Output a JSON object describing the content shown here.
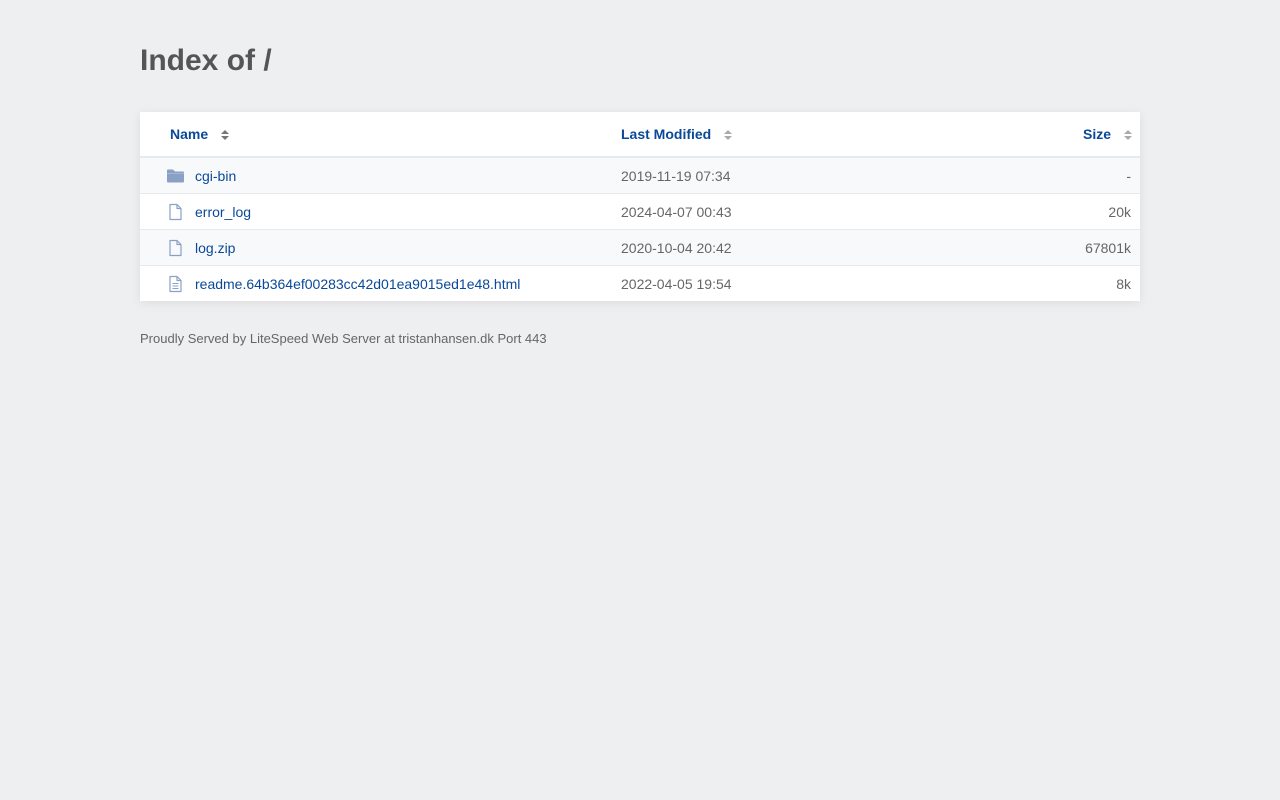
{
  "page": {
    "title": "Index of /"
  },
  "columns": {
    "name": "Name",
    "last_modified": "Last Modified",
    "size": "Size"
  },
  "entries": [
    {
      "name": "cgi-bin",
      "modified": "2019-11-19 07:34",
      "size": "-",
      "icon": "folder-icon"
    },
    {
      "name": "error_log",
      "modified": "2024-04-07 00:43",
      "size": "20k",
      "icon": "file-icon"
    },
    {
      "name": "log.zip",
      "modified": "2020-10-04 20:42",
      "size": "67801k",
      "icon": "file-icon"
    },
    {
      "name": "readme.64b364ef00283cc42d01ea9015ed1e48.html",
      "modified": "2022-04-05 19:54",
      "size": "8k",
      "icon": "text-file-icon"
    }
  ],
  "footer": {
    "text": "Proudly Served by LiteSpeed Web Server at tristanhansen.dk Port 443"
  },
  "colors": {
    "background": "#eeeff1",
    "link": "#0a4899",
    "icon": "#8aa0c4"
  }
}
